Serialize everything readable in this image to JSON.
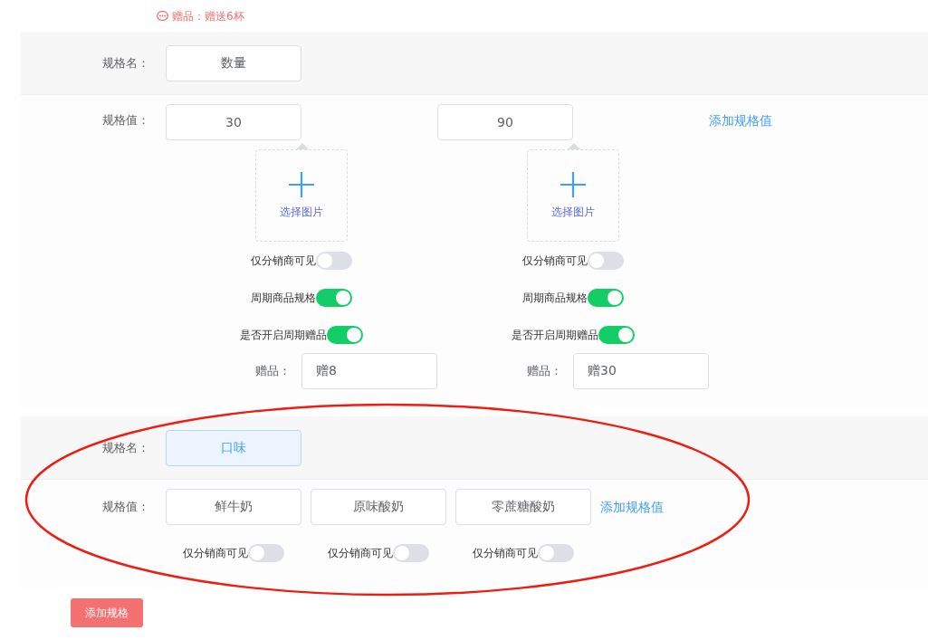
{
  "gift_note": {
    "text": "赠品：赠送6杯"
  },
  "specs": [
    {
      "kind": "detailed",
      "name_label": "规格名：",
      "name": "数量",
      "name_selected": false,
      "value_label": "规格值：",
      "add_value_link": "添加规格值",
      "values": [
        {
          "value": "30",
          "image_label": "选择图片",
          "toggles": [
            {
              "label": "仅分销商可见",
              "on": false
            },
            {
              "label": "周期商品规格",
              "on": true
            },
            {
              "label": "是否开启周期赠品",
              "on": true
            }
          ],
          "gift_label": "赠品：",
          "gift": "赠8"
        },
        {
          "value": "90",
          "image_label": "选择图片",
          "toggles": [
            {
              "label": "仅分销商可见",
              "on": false
            },
            {
              "label": "周期商品规格",
              "on": true
            },
            {
              "label": "是否开启周期赠品",
              "on": true
            }
          ],
          "gift_label": "赠品：",
          "gift": "赠30"
        }
      ]
    },
    {
      "kind": "compact",
      "name_label": "规格名：",
      "name": "口味",
      "name_selected": true,
      "value_label": "规格值：",
      "add_value_link": "添加规格值",
      "values": [
        {
          "value": "鲜牛奶",
          "toggles": [
            {
              "label": "仅分销商可见",
              "on": false
            }
          ]
        },
        {
          "value": "原味酸奶",
          "toggles": [
            {
              "label": "仅分销商可见",
              "on": false
            }
          ]
        },
        {
          "value": "零蔗糖酸奶",
          "toggles": [
            {
              "label": "仅分销商可见",
              "on": false
            }
          ]
        }
      ]
    }
  ],
  "add_spec_button": "添加规格",
  "annotation": {
    "kind": "ellipse"
  }
}
